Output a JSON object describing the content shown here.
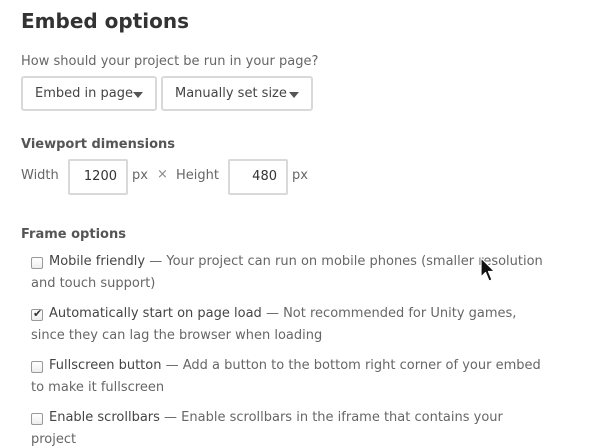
{
  "title": "Embed options",
  "run_question": "How should your project be run in your page?",
  "embed_select": {
    "value": "Embed in page"
  },
  "size_select": {
    "value": "Manually set size"
  },
  "viewport": {
    "label": "Viewport dimensions",
    "width_label": "Width",
    "width_value": "1200",
    "width_unit": "px",
    "times": "×",
    "height_label": "Height",
    "height_value": "480",
    "height_unit": "px"
  },
  "frame": {
    "label": "Frame options",
    "options": [
      {
        "name": "Mobile friendly",
        "desc": " — Your project can run on mobile phones (smaller resolution and touch support)",
        "checked": false
      },
      {
        "name": "Automatically start on page load",
        "desc": " — Not recommended for Unity games, since they can lag the browser when loading",
        "checked": true
      },
      {
        "name": "Fullscreen button",
        "desc": " — Add a button to the bottom right corner of your embed to make it fullscreen",
        "checked": false
      },
      {
        "name": "Enable scrollbars",
        "desc": " — Enable scrollbars in the iframe that contains your project",
        "checked": false
      }
    ]
  },
  "icons": {
    "dropdown": "caret-down-icon",
    "checkmark": "checkmark-icon",
    "cursor": "mouse-pointer-icon"
  }
}
